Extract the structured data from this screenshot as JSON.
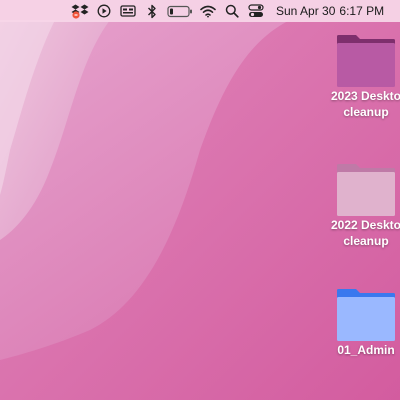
{
  "menubar": {
    "icons": [
      "dropbox-icon",
      "play-circle-icon",
      "screen-mirroring-icon",
      "bluetooth-icon",
      "battery-icon",
      "wifi-icon",
      "search-icon",
      "control-center-icon"
    ],
    "date": "Sun Apr 30",
    "time": "6:17 PM"
  },
  "desktop": {
    "items": [
      {
        "line1": "2023 Deskto",
        "line2": "cleanup",
        "icon": "folder-icon",
        "color": "#b85aa4"
      },
      {
        "line1": "2022 Deskto",
        "line2": "cleanup",
        "icon": "folder-icon",
        "color": "#e0b2cd"
      },
      {
        "line1": "01_Admin",
        "icon": "folder-icon",
        "color": "#9ab8ff"
      }
    ]
  },
  "colors": {
    "wallpaper": "#d766a6",
    "menubar": "#f6d6e8"
  }
}
